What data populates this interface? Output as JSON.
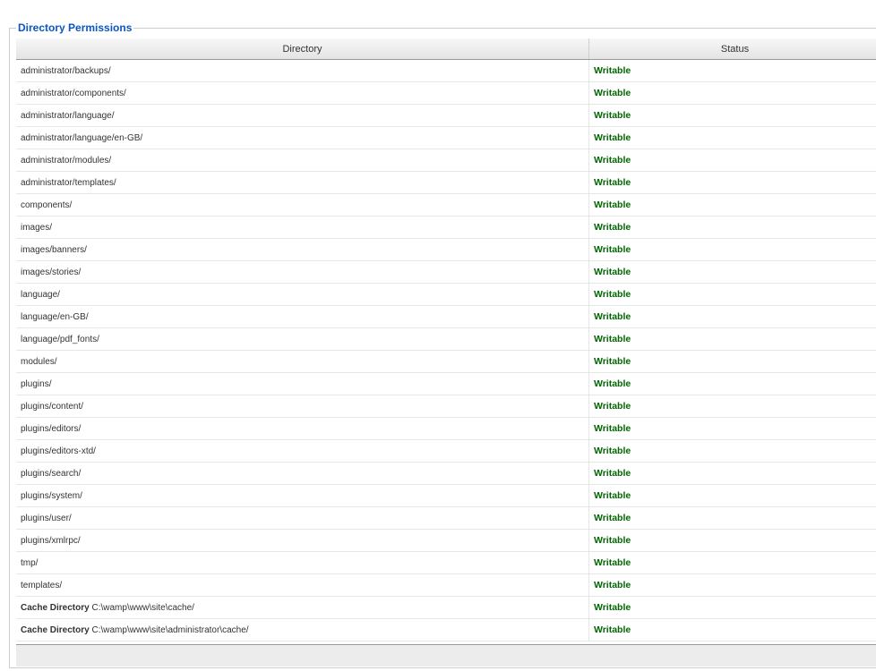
{
  "panel": {
    "legend": "Directory Permissions"
  },
  "table": {
    "headers": {
      "directory": "Directory",
      "status": "Status"
    },
    "rows": [
      {
        "prefix": "",
        "path": "administrator/backups/",
        "status": "Writable"
      },
      {
        "prefix": "",
        "path": "administrator/components/",
        "status": "Writable"
      },
      {
        "prefix": "",
        "path": "administrator/language/",
        "status": "Writable"
      },
      {
        "prefix": "",
        "path": "administrator/language/en-GB/",
        "status": "Writable"
      },
      {
        "prefix": "",
        "path": "administrator/modules/",
        "status": "Writable"
      },
      {
        "prefix": "",
        "path": "administrator/templates/",
        "status": "Writable"
      },
      {
        "prefix": "",
        "path": "components/",
        "status": "Writable"
      },
      {
        "prefix": "",
        "path": "images/",
        "status": "Writable"
      },
      {
        "prefix": "",
        "path": "images/banners/",
        "status": "Writable"
      },
      {
        "prefix": "",
        "path": "images/stories/",
        "status": "Writable"
      },
      {
        "prefix": "",
        "path": "language/",
        "status": "Writable"
      },
      {
        "prefix": "",
        "path": "language/en-GB/",
        "status": "Writable"
      },
      {
        "prefix": "",
        "path": "language/pdf_fonts/",
        "status": "Writable"
      },
      {
        "prefix": "",
        "path": "modules/",
        "status": "Writable"
      },
      {
        "prefix": "",
        "path": "plugins/",
        "status": "Writable"
      },
      {
        "prefix": "",
        "path": "plugins/content/",
        "status": "Writable"
      },
      {
        "prefix": "",
        "path": "plugins/editors/",
        "status": "Writable"
      },
      {
        "prefix": "",
        "path": "plugins/editors-xtd/",
        "status": "Writable"
      },
      {
        "prefix": "",
        "path": "plugins/search/",
        "status": "Writable"
      },
      {
        "prefix": "",
        "path": "plugins/system/",
        "status": "Writable"
      },
      {
        "prefix": "",
        "path": "plugins/user/",
        "status": "Writable"
      },
      {
        "prefix": "",
        "path": "plugins/xmlrpc/",
        "status": "Writable"
      },
      {
        "prefix": "",
        "path": "tmp/",
        "status": "Writable"
      },
      {
        "prefix": "",
        "path": "templates/",
        "status": "Writable"
      },
      {
        "prefix": "Cache Directory",
        "path": "C:\\wamp\\www\\site\\cache/",
        "status": "Writable"
      },
      {
        "prefix": "Cache Directory",
        "path": "C:\\wamp\\www\\site\\administrator\\cache/",
        "status": "Writable"
      }
    ]
  },
  "colors": {
    "legend": "#0b55c4",
    "writable": "#006600"
  }
}
